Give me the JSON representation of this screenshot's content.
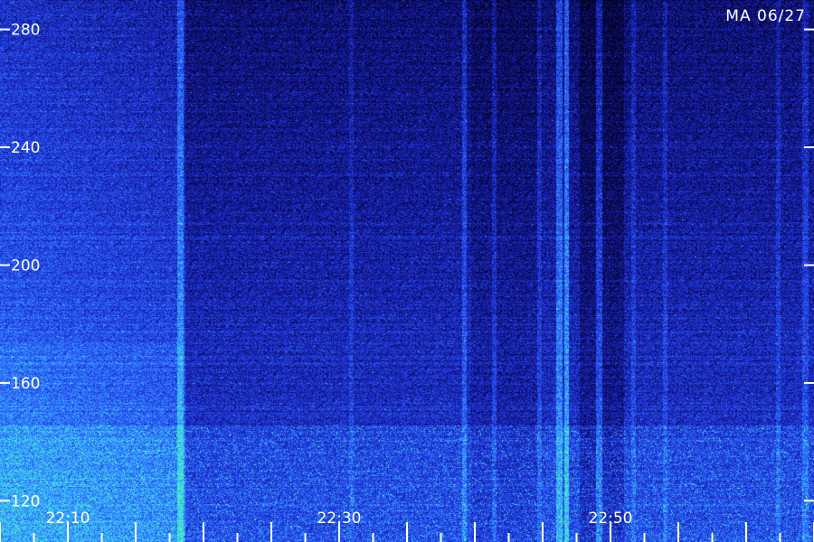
{
  "stamp": "MA 06/27",
  "chart_data": {
    "type": "heatmap",
    "title": "",
    "xlabel": "",
    "ylabel": "",
    "x_ticks": [
      "22:10",
      "22:30",
      "22:50"
    ],
    "y_ticks": [
      280,
      240,
      200,
      160,
      120
    ],
    "ylim": [
      106,
      290
    ],
    "xlim": [
      "22:05",
      "23:05"
    ],
    "colormap": [
      "#000010",
      "#0a0a5a",
      "#1d2bd0",
      "#2f6dff",
      "#3fd0ff",
      "#4dff9a"
    ],
    "grid": false,
    "legend": "none"
  }
}
